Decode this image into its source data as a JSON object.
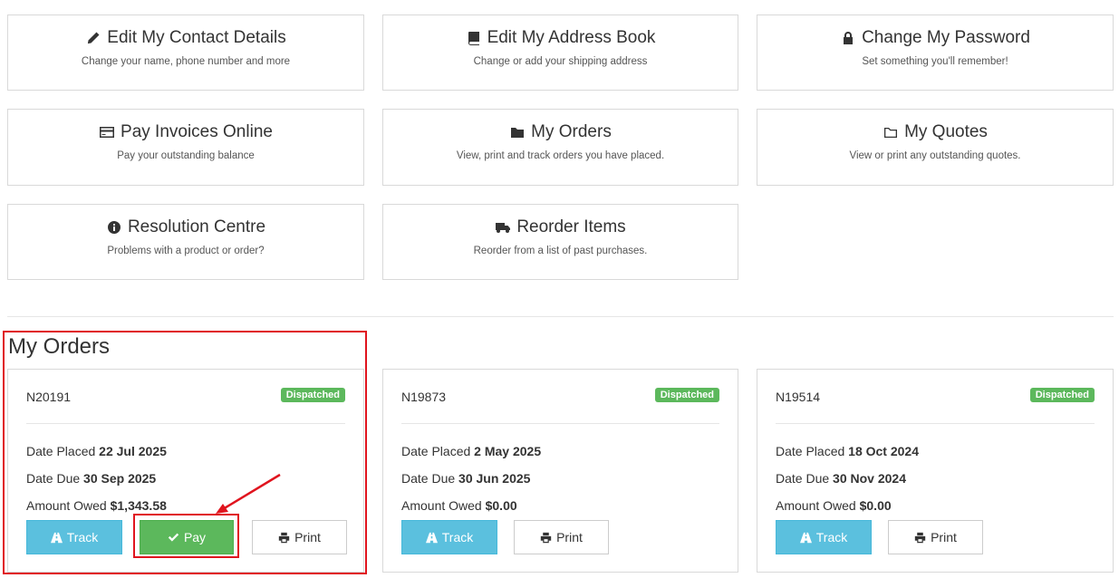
{
  "tiles": [
    {
      "title": "Edit My Contact Details",
      "subtitle": "Change your name, phone number and more",
      "icon": "pencil-icon"
    },
    {
      "title": "Edit My Address Book",
      "subtitle": "Change or add your shipping address",
      "icon": "book-icon"
    },
    {
      "title": "Change My Password",
      "subtitle": "Set something you'll remember!",
      "icon": "lock-icon"
    },
    {
      "title": "Pay Invoices Online",
      "subtitle": "Pay your outstanding balance",
      "icon": "credit-card-icon"
    },
    {
      "title": "My Orders",
      "subtitle": "View, print and track orders you have placed.",
      "icon": "folder-icon"
    },
    {
      "title": "My Quotes",
      "subtitle": "View or print any outstanding quotes.",
      "icon": "folder-open-icon"
    },
    {
      "title": "Resolution Centre",
      "subtitle": "Problems with a product or order?",
      "icon": "info-circle-icon"
    },
    {
      "title": "Reorder Items",
      "subtitle": "Reorder from a list of past purchases.",
      "icon": "truck-icon"
    }
  ],
  "orders_section": {
    "title": "My Orders"
  },
  "orders": [
    {
      "number": "N20191",
      "status": "Dispatched",
      "date_placed_label": "Date Placed",
      "date_placed": "22 Jul 2025",
      "date_due_label": "Date Due",
      "date_due": "30 Sep 2025",
      "amount_label": "Amount Owed",
      "amount": "$1,343.58",
      "track_label": "Track",
      "pay_label": "Pay",
      "print_label": "Print"
    },
    {
      "number": "N19873",
      "status": "Dispatched",
      "date_placed_label": "Date Placed",
      "date_placed": "2 May 2025",
      "date_due_label": "Date Due",
      "date_due": "30 Jun 2025",
      "amount_label": "Amount Owed",
      "amount": "$0.00",
      "track_label": "Track",
      "print_label": "Print"
    },
    {
      "number": "N19514",
      "status": "Dispatched",
      "date_placed_label": "Date Placed",
      "date_placed": "18 Oct 2024",
      "date_due_label": "Date Due",
      "date_due": "30 Nov 2024",
      "amount_label": "Amount Owed",
      "amount": "$0.00",
      "track_label": "Track",
      "print_label": "Print"
    }
  ],
  "colors": {
    "success": "#5cb85c",
    "info": "#5bc0de",
    "annotation": "#e0141e"
  }
}
